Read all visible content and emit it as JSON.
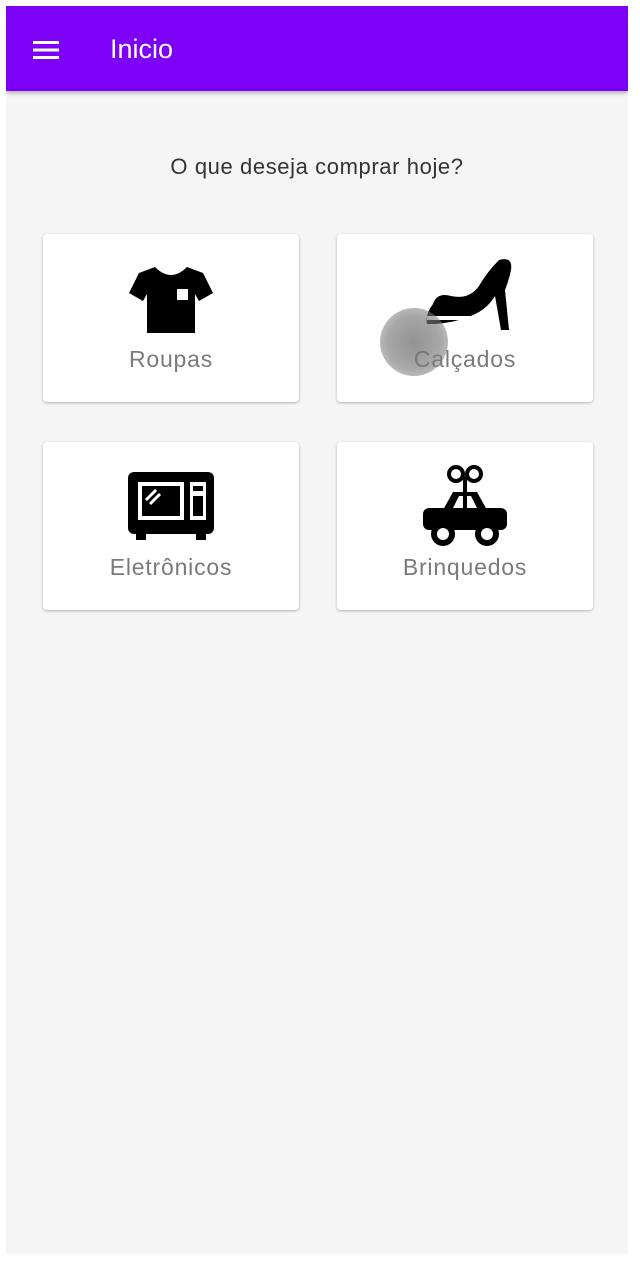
{
  "app_bar": {
    "title": "Inicio",
    "menu_icon": "menu-icon",
    "color": "#7d00f7"
  },
  "main": {
    "question": "O que deseja comprar hoje?"
  },
  "categories": [
    {
      "label": "Roupas",
      "icon": "shirt-icon"
    },
    {
      "label": "Calçados",
      "icon": "high-heel-shoe-icon"
    },
    {
      "label": "Eletrônicos",
      "icon": "microwave-icon"
    },
    {
      "label": "Brinquedos",
      "icon": "toy-car-icon"
    }
  ]
}
